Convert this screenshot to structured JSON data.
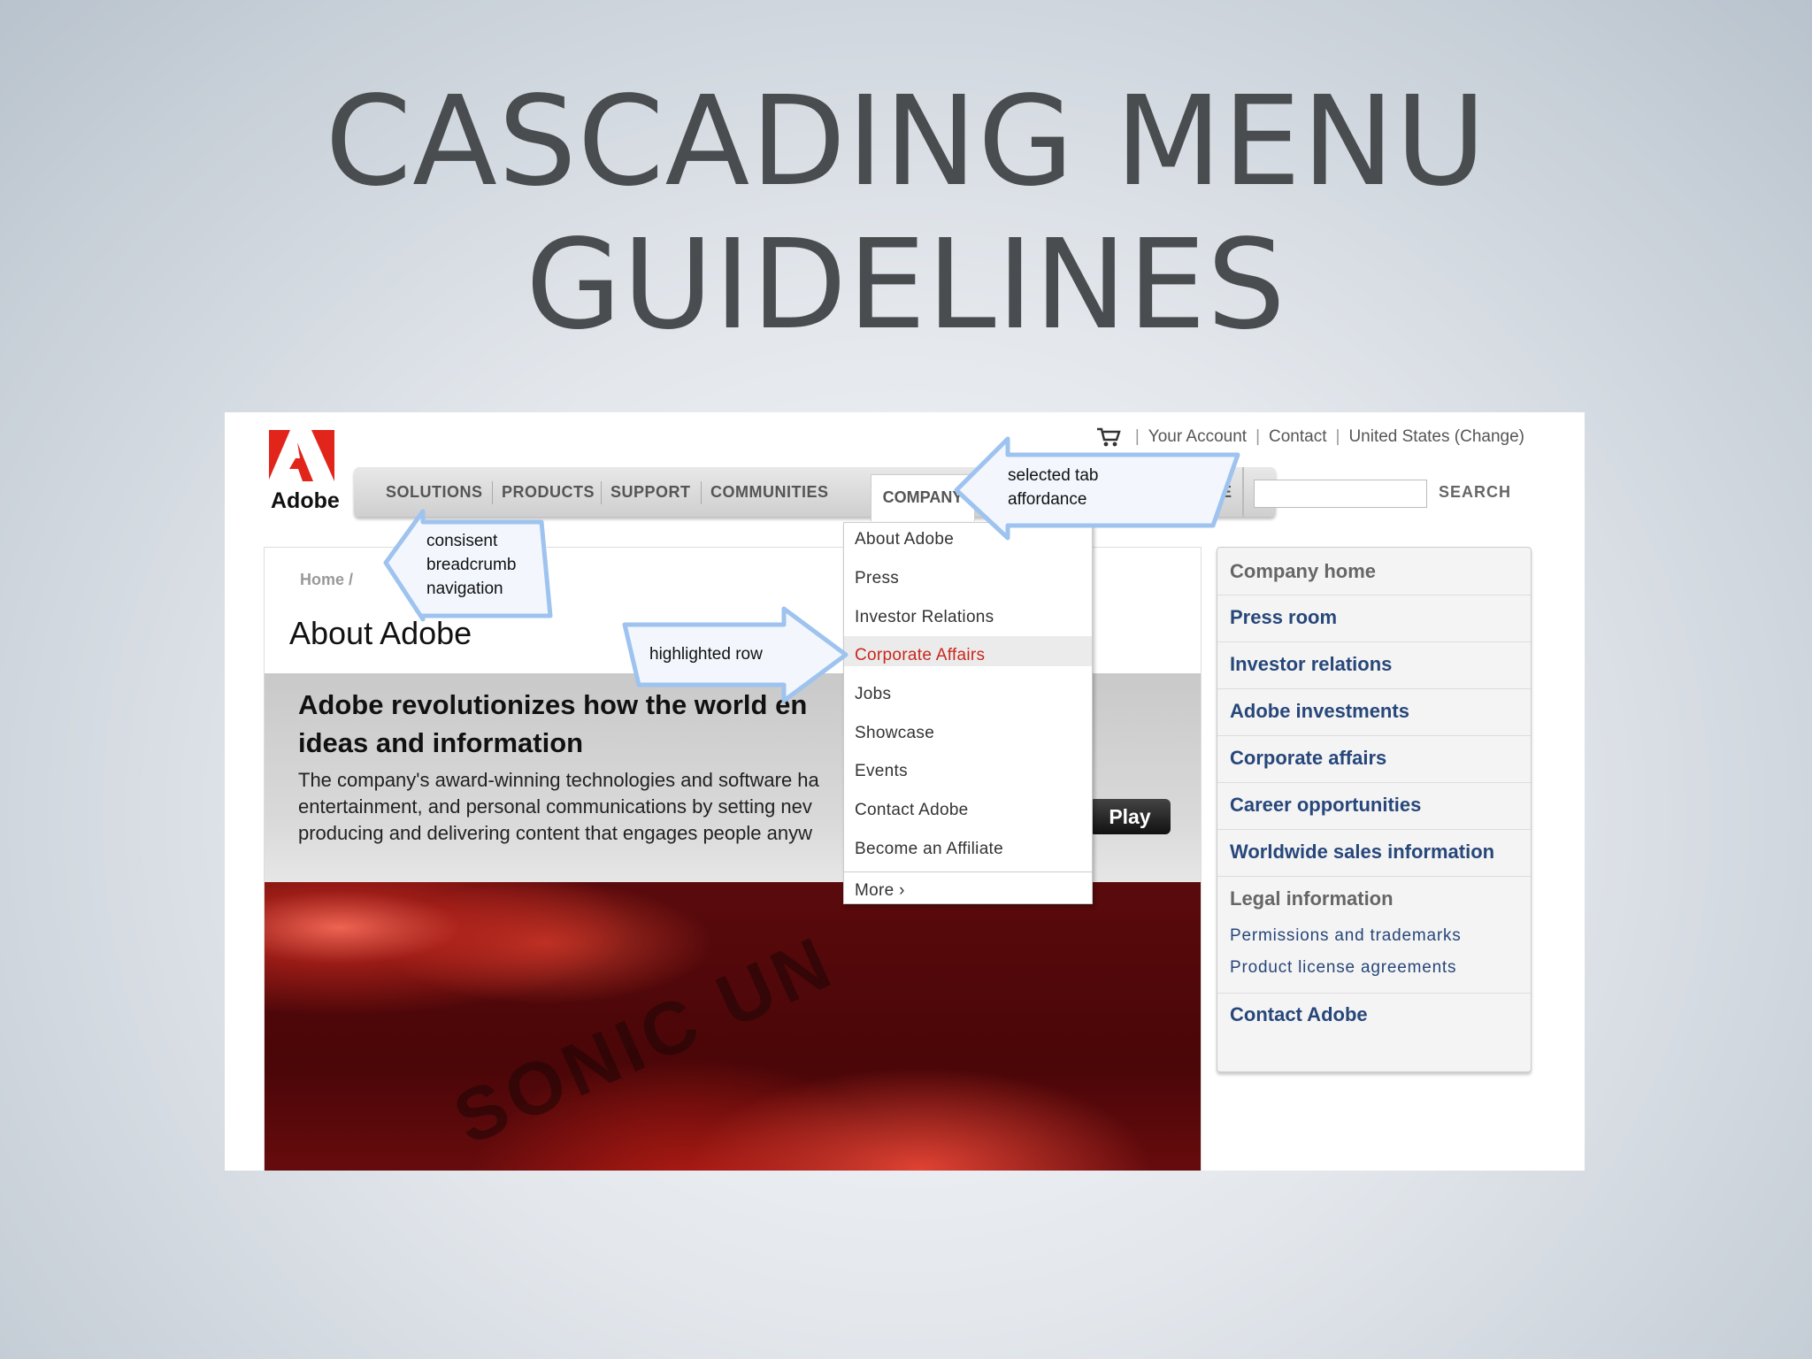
{
  "slide": {
    "title_line1": "CASCADING MENU",
    "title_line2": "GUIDELINES"
  },
  "site": {
    "logo_text": "Adobe",
    "utility": {
      "account": "Your Account",
      "contact": "Contact",
      "region": "United States (Change)"
    },
    "nav": {
      "tabs": [
        "SOLUTIONS",
        "PRODUCTS",
        "SUPPORT",
        "COMMUNITIES",
        "COMPANY"
      ],
      "active_tab": "COMPANY",
      "partial_tab_fragment": "E",
      "search_label": "SEARCH",
      "search_value": ""
    },
    "breadcrumb": "Home /",
    "page_title": "About Adobe",
    "hero": {
      "headline_line1": "Adobe revolutionizes how the world en",
      "headline_line2": "ideas and information",
      "body_line1": "The company's award-winning technologies and software ha",
      "body_line2": "entertainment, and personal communications by setting nev",
      "body_line3": "producing and delivering content that engages people anyw",
      "play_label": "Play"
    },
    "dropdown": {
      "items": [
        "About Adobe",
        "Press",
        "Investor Relations",
        "Corporate Affairs",
        "Jobs",
        "Showcase",
        "Events",
        "Contact Adobe",
        "Become an Affiliate"
      ],
      "highlighted": "Corporate Affairs",
      "more_label": "More ›"
    },
    "sidebar": {
      "items": [
        "Company home",
        "Press room",
        "Investor relations",
        "Adobe investments",
        "Corporate affairs",
        "Career opportunities",
        "Worldwide sales information",
        "Legal information",
        "Contact Adobe"
      ],
      "legal_sublinks": [
        "Permissions and trademarks",
        "Product license agreements"
      ]
    },
    "video_overlay_text": "SONIC UN"
  },
  "callouts": {
    "selected_tab_line1": "selected tab",
    "selected_tab_line2": "affordance",
    "breadcrumb_line1": "consisent",
    "breadcrumb_line2": "breadcrumb",
    "breadcrumb_line3": "navigation",
    "highlighted_row": "highlighted row"
  },
  "colors": {
    "brand_red": "#e1251b",
    "highlight_text": "#c8281e",
    "link_blue": "#27477a",
    "callout_fill": "#f3f7fd",
    "callout_stroke": "#9ec3ef"
  },
  "icons": {
    "cart": "shopping-cart-icon",
    "logo": "adobe-logo-icon",
    "arrows": "callout-arrow-icon"
  }
}
